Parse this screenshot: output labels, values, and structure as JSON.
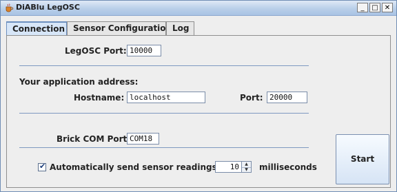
{
  "window": {
    "title": "DiABlu LegOSC"
  },
  "title_buttons": {
    "minimize": "_",
    "maximize": "□",
    "close": "✕"
  },
  "tabs": [
    {
      "label": "Connection",
      "active": true
    },
    {
      "label": "Sensor Configuration",
      "active": false
    },
    {
      "label": "Log",
      "active": false
    }
  ],
  "connection": {
    "legosc_port_label": "LegOSC Port:",
    "legosc_port_value": "10000",
    "app_address_label": "Your application address:",
    "hostname_label": "Hostname:",
    "hostname_value": "localhost",
    "port_label": "Port:",
    "port_value": "20000",
    "brick_com_label": "Brick COM Port:",
    "brick_com_value": "COM18",
    "auto_send_label": "Automatically send sensor readings every",
    "auto_send_checked": true,
    "auto_send_value": "10",
    "milliseconds_label": "milliseconds",
    "start_label": "Start"
  },
  "colors": {
    "accent": "#6c8fbf",
    "separator": "#7d98c0",
    "titlebar": "#b9cfe9"
  },
  "icons": {
    "app": "coffee-cup-icon",
    "check": "check-icon"
  }
}
